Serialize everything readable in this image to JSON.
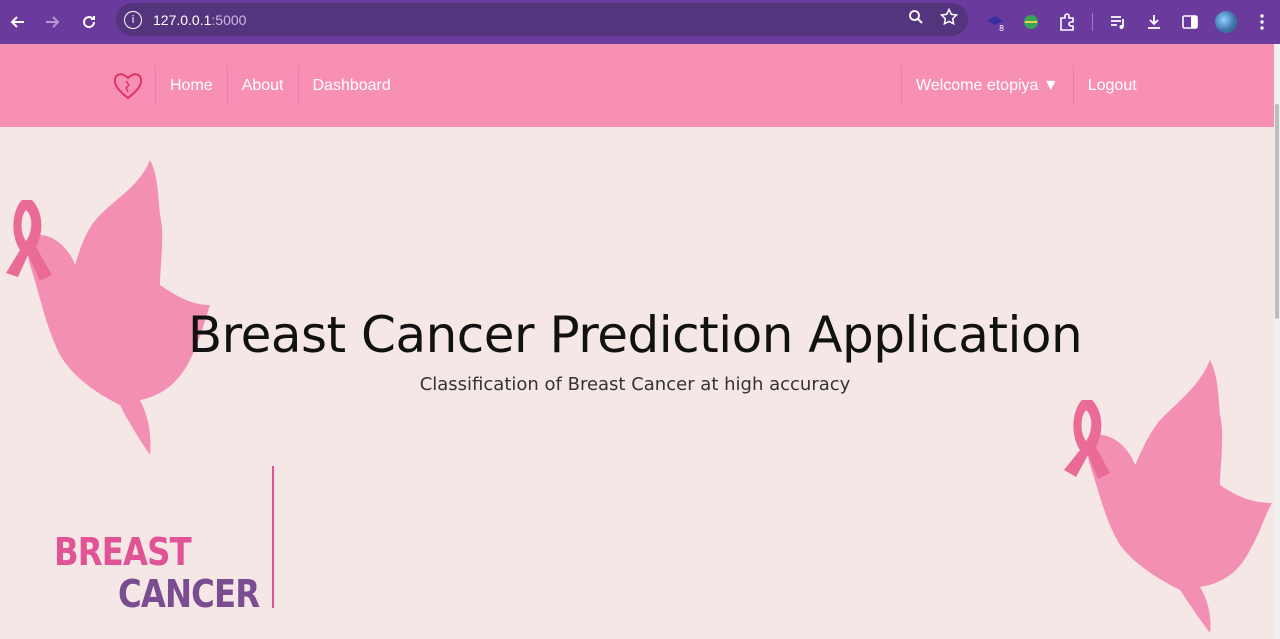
{
  "browser": {
    "url_host": "127.0.0.1",
    "url_port": ":5000"
  },
  "nav": {
    "links": [
      "Home",
      "About",
      "Dashboard"
    ],
    "welcome": "Welcome etopiya ▼",
    "logout": "Logout"
  },
  "hero": {
    "title": "Breast Cancer Prediction Application",
    "subtitle": "Classification of Breast Cancer at high accuracy"
  },
  "logo": {
    "word1": "BREAST",
    "word2": "CANCER"
  },
  "colors": {
    "chrome": "#6a3a9c",
    "header": "#f890b5",
    "background": "#f6e7e7",
    "logo_pink": "#e05394",
    "logo_purple": "#7a4d91"
  }
}
